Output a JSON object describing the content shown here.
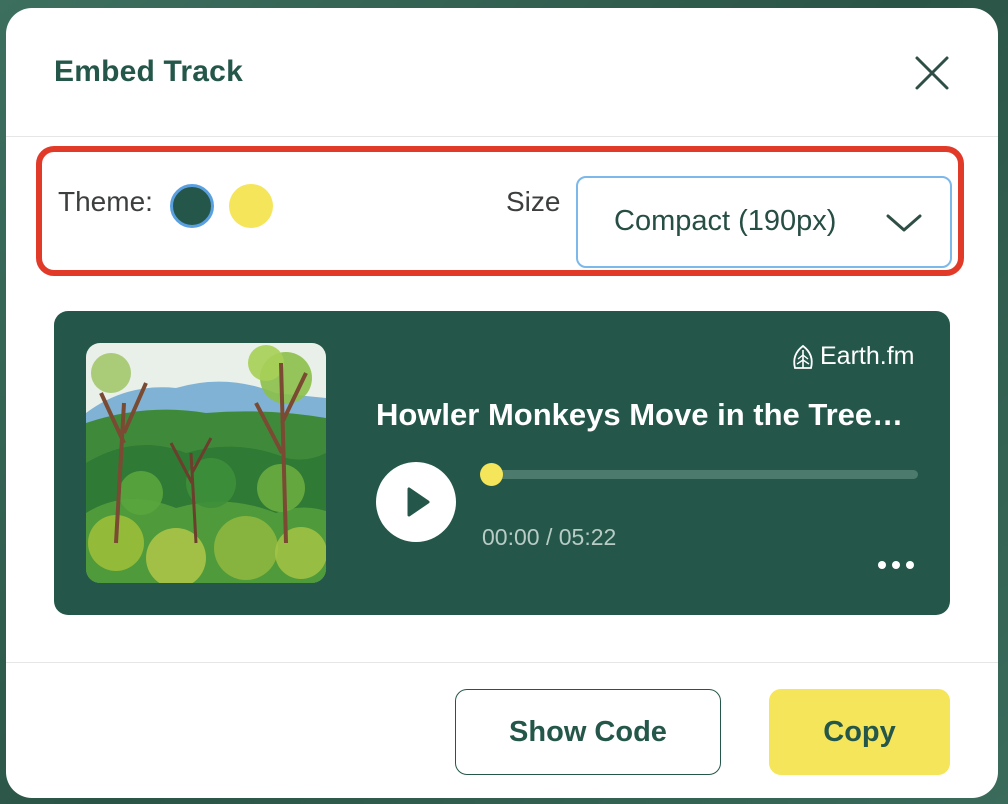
{
  "modal": {
    "title": "Embed Track",
    "close_icon": "close-icon"
  },
  "options": {
    "theme_label": "Theme:",
    "themes": [
      {
        "name": "green",
        "color": "#24574a",
        "selected": true
      },
      {
        "name": "yellow",
        "color": "#f4e55a",
        "selected": false
      }
    ],
    "size_label": "Size",
    "size_selected": "Compact (190px)",
    "size_icon": "chevron-down-icon"
  },
  "player": {
    "brand": "Earth.fm",
    "brand_icon": "leaf-icon",
    "track_title": "Howler Monkeys Move in the Trees in Costa Rica",
    "play_icon": "play-icon",
    "progress": 0.02,
    "current_time": "00:00",
    "duration": "05:22",
    "time_separator": "/",
    "more_icon": "more-dots-icon",
    "background_color": "#24574a"
  },
  "footer": {
    "show_code_label": "Show Code",
    "copy_label": "Copy"
  },
  "colors": {
    "brand_green": "#24574a",
    "accent_yellow": "#f4e55a",
    "highlight_red": "#e23a28",
    "focus_blue": "#7cb8ea"
  }
}
